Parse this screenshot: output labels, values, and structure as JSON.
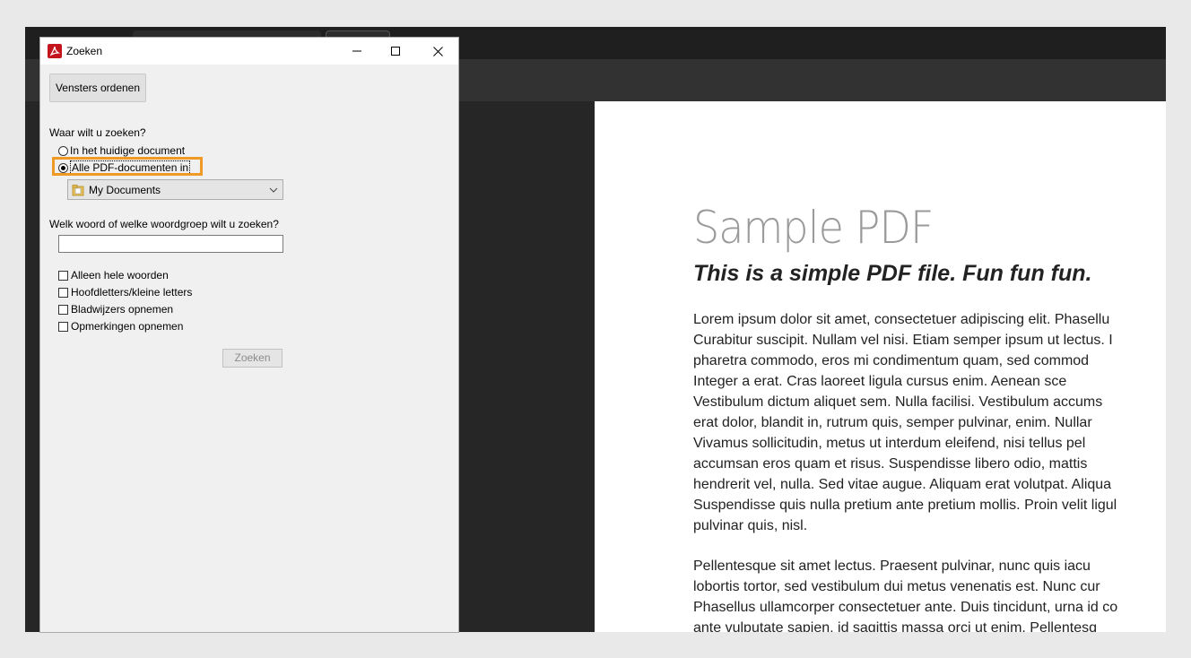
{
  "dialog": {
    "title": "Zoeken",
    "arrange_button": "Vensters ordenen",
    "where_label": "Waar wilt u zoeken?",
    "scope_options": [
      {
        "label": "In het huidige document",
        "selected": false
      },
      {
        "label": "Alle PDF-documenten in",
        "selected": true
      }
    ],
    "folder_select": {
      "value": "My Documents"
    },
    "query_label": "Welk woord of welke woordgroep wilt u zoeken?",
    "query_value": "",
    "options": [
      {
        "label": "Alleen hele woorden",
        "checked": false
      },
      {
        "label": "Hoofdletters/kleine letters",
        "checked": false
      },
      {
        "label": "Bladwijzers opnemen",
        "checked": false
      },
      {
        "label": "Opmerkingen opnemen",
        "checked": false
      }
    ],
    "search_button": "Zoeken",
    "highlight_color": "#f09a26"
  },
  "pdf": {
    "title": "Sample PDF",
    "subtitle": "This is a simple PDF file. Fun fun fun.",
    "paragraph1": [
      "Lorem ipsum dolor sit amet, consectetuer adipiscing elit. Phasellu",
      "Curabitur suscipit. Nullam vel nisi. Etiam semper ipsum ut lectus. I",
      "pharetra commodo, eros mi condimentum quam, sed commod",
      "Integer a erat. Cras laoreet ligula cursus enim. Aenean sce",
      "Vestibulum dictum aliquet sem. Nulla facilisi. Vestibulum accums",
      "erat dolor, blandit in, rutrum quis, semper pulvinar, enim. Nullar",
      "Vivamus sollicitudin, metus ut interdum eleifend, nisi tellus pel",
      "accumsan eros quam et risus. Suspendisse libero odio, mattis",
      "hendrerit vel, nulla. Sed vitae augue. Aliquam erat volutpat. Aliqua",
      "Suspendisse quis nulla pretium ante pretium mollis. Proin velit ligul",
      "pulvinar quis, nisl."
    ],
    "paragraph2": [
      "Pellentesque sit amet lectus. Praesent pulvinar, nunc quis iacu",
      "lobortis tortor, sed vestibulum dui metus venenatis est. Nunc cur",
      "Phasellus ullamcorper consectetuer ante. Duis tincidunt, urna id co",
      "ante vulputate sapien, id sagittis massa orci ut enim. Pellentesq"
    ]
  }
}
